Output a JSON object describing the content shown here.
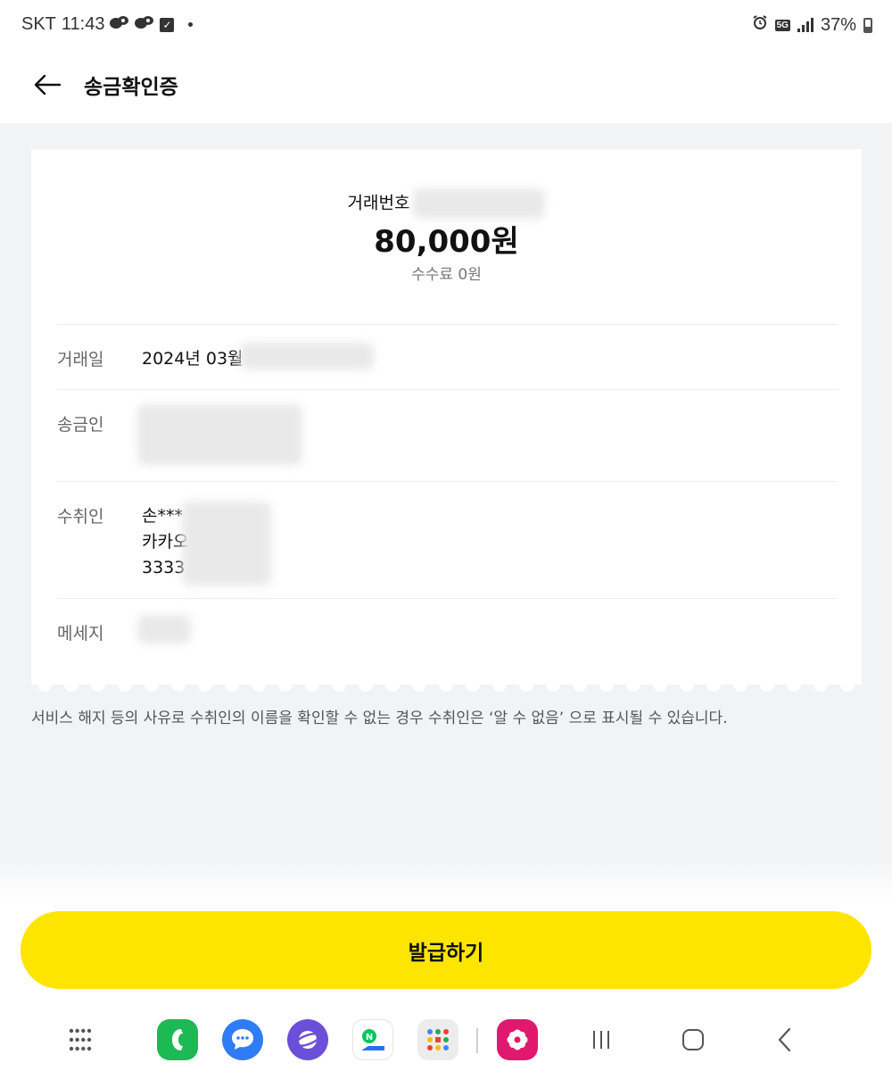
{
  "status_bar": {
    "carrier": "SKT",
    "time": "11:43",
    "network": "5G",
    "battery": "37%"
  },
  "header": {
    "title": "송금확인증"
  },
  "receipt": {
    "transaction_label": "거래번호",
    "amount": "80,000원",
    "fee": "수수료 0원",
    "rows": [
      {
        "label": "거래일",
        "value": "2024년 03월"
      },
      {
        "label": "송금인",
        "value": ""
      },
      {
        "label": "수취인",
        "lines": [
          "손***",
          "카카오",
          "3333"
        ]
      },
      {
        "label": "메세지",
        "value": ""
      }
    ]
  },
  "notice": "서비스 해지 등의 사유로 수취인의 이름을 확인할 수 없는 경우 수취인은 ‘알 수 없음’ 으로 표시될 수 있습니다.",
  "issue_button": {
    "label": "발급하기"
  },
  "colors": {
    "accent": "#fee500",
    "page_bg": "#f2f3f5",
    "card_bg": "#ffffff"
  },
  "nav_bar": {
    "apps": [
      "app-drawer-icon",
      "phone-icon",
      "messages-icon",
      "internet-icon",
      "naver-map-icon",
      "google-folder-icon",
      "flower-app-icon"
    ],
    "system": [
      "recents-icon",
      "home-icon",
      "back-icon"
    ]
  }
}
